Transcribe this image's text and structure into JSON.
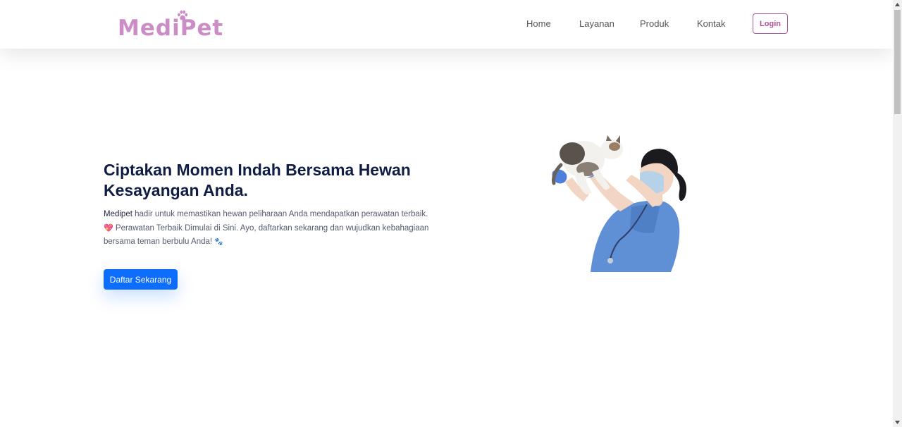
{
  "brand": {
    "logo_text": "MediPet",
    "logo_color": "#cc8dc6",
    "logo_icon": "paw-icon"
  },
  "nav": {
    "items": [
      {
        "label": "Home"
      },
      {
        "label": "Layanan"
      },
      {
        "label": "Produk"
      },
      {
        "label": "Kontak"
      }
    ],
    "login_label": "Login",
    "login_color": "#b0589f"
  },
  "hero": {
    "title": "Ciptakan Momen Indah Bersama Hewan Kesayangan Anda.",
    "description": {
      "brand": "Medipet",
      "line1": " hadir untuk memastikan hewan peliharaan Anda mendapatkan perawatan terbaik.",
      "heart": "💖",
      "line2": " Perawatan Terbaik Dimulai di Sini. Ayo, daftarkan sekarang dan wujudkan kebahagiaan bersama teman berbulu Anda! ",
      "paws": "🐾"
    },
    "cta_label": "Daftar Sekarang",
    "cta_color": "#0d6efd",
    "illustration": "vet-holding-cat-image"
  }
}
